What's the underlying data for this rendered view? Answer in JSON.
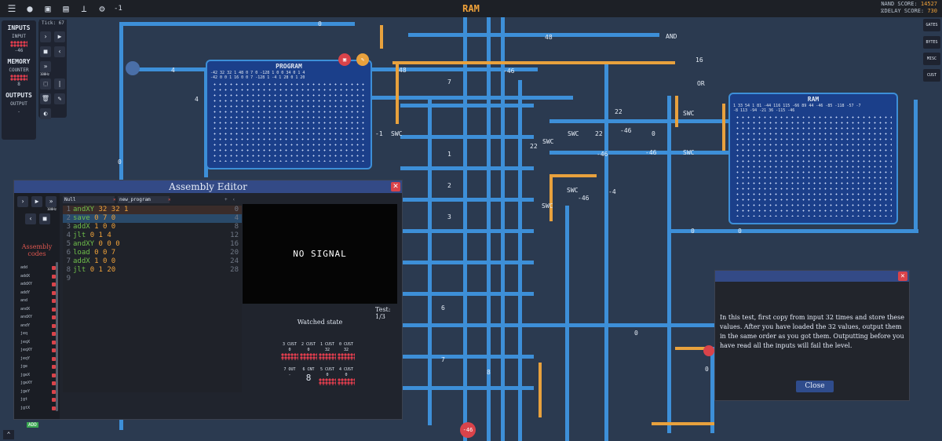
{
  "topbar": {
    "title": "RAM",
    "counter": "-1",
    "nand_label": "NAND SCORE:",
    "nand_value": "14527",
    "delay_label": "DELAY SCORE:",
    "delay_value": "730"
  },
  "left_panel": {
    "inputs_header": "INPUTS",
    "input_label": "INPUT",
    "input_value": "-46",
    "memory_header": "MEMORY",
    "counter_label": "COUNTER",
    "counter_value": "8",
    "outputs_header": "OUTPUTS",
    "output_label": "OUTPUT",
    "output_value": "-"
  },
  "controls": {
    "tick": "Tick: 67",
    "speed": "100Hz"
  },
  "right_tabs": [
    "GATES",
    "BYTES",
    "MISC",
    "CUST"
  ],
  "program_block": {
    "label": "PROGRAM",
    "row1": "-42  32  32   1   48   0   7   0  -128  1    0    0   34   0   1    4",
    "row2": "-42  0   0    1   16   0   0   7  -128  1   -4    1   28   0   1   20"
  },
  "ram_block": {
    "label": "RAM",
    "row1": "1   33  54   1   81  -44  116 115  -66  89   44   -46  -85  -118  -57  -7",
    "row2": "-8  113 -94  -21  36  -115 -46"
  },
  "editor": {
    "title": "Assembly Editor",
    "speed": "100Hz",
    "assembly_codes_title": "Assembly codes",
    "opcodes": [
      "add",
      "addX",
      "addXY",
      "addY",
      "and",
      "andX",
      "andXY",
      "andY",
      "jeq",
      "jeqX",
      "jeqXY",
      "jeqY",
      "jge",
      "jgeX",
      "jgeXY",
      "jgeY",
      "jgt",
      "jgtX"
    ],
    "add_label": "ADD",
    "tabs": [
      "Null",
      "new_program"
    ],
    "lines": [
      {
        "num": "1",
        "op": "andXY",
        "args": "32 32 1",
        "addr": "0"
      },
      {
        "num": "2",
        "op": "save",
        "args": "0 7 0",
        "addr": "4"
      },
      {
        "num": "3",
        "op": "addX",
        "args": "1 0 0",
        "addr": "8"
      },
      {
        "num": "4",
        "op": "jlt",
        "args": "0 1 4",
        "addr": "12"
      },
      {
        "num": "5",
        "op": "andXY",
        "args": "0 0 0",
        "addr": "16"
      },
      {
        "num": "6",
        "op": "load",
        "args": "0 0 7",
        "addr": "20"
      },
      {
        "num": "7",
        "op": "addX",
        "args": "1 0 0",
        "addr": "24"
      },
      {
        "num": "8",
        "op": "jlt",
        "args": "0 1 20",
        "addr": "28"
      },
      {
        "num": "9",
        "op": "",
        "args": "",
        "addr": ""
      }
    ],
    "monitor_text": "NO SIGNAL",
    "test": "Test: 1/3",
    "watched_title": "Watched state",
    "registers": [
      {
        "label": "3 CUST",
        "value": "0"
      },
      {
        "label": "2 CUST",
        "value": "0"
      },
      {
        "label": "1 CUST",
        "value": "32"
      },
      {
        "label": "0 CUST",
        "value": "32"
      },
      {
        "label": "7 OUT",
        "value": "-"
      },
      {
        "label": "6 CNT",
        "value": "8"
      },
      {
        "label": "5 CUST",
        "value": "0"
      },
      {
        "label": "4 CUST",
        "value": "0"
      }
    ]
  },
  "dialog": {
    "message": "In this test, first copy from input 32 times and store these values. After you have loaded the 32 values, output them in the same order as you got them. Outputting before you have read all the inputs will fail the level.",
    "close_label": "Close"
  },
  "circuit_labels": [
    "4",
    "4",
    "4",
    "0",
    "48",
    "48",
    "7",
    "-46",
    "-46",
    "-46",
    "22",
    "22",
    "22",
    "0",
    "0",
    "-4",
    "-46",
    "-46",
    "0",
    "0",
    "0",
    "0",
    "SWC",
    "SWC",
    "SWC",
    "SWC",
    "SWC",
    "SWC",
    "SWC",
    "AND",
    "OR",
    "-1",
    "1",
    "2",
    "3",
    "6",
    "7",
    "8",
    "16",
    "-46"
  ],
  "colors": {
    "bus": "#3d8fd8",
    "bus_orange": "#e8a13d",
    "background": "#2b3a50",
    "accent": "#f0a23a",
    "error": "#d9434a"
  }
}
